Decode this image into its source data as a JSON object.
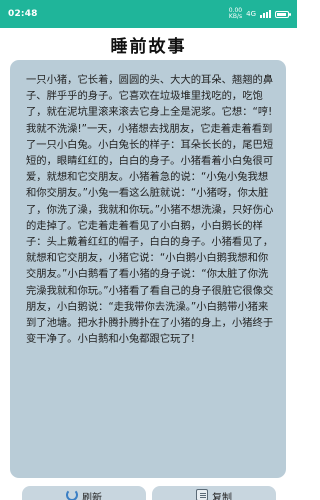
{
  "status_bar": {
    "time": "02:48",
    "speed_value": "0.00",
    "speed_unit": "KB/s",
    "network": "4G",
    "battery_level": 0.85
  },
  "header": {
    "title": "睡前故事"
  },
  "story": {
    "text": "一只小猪，它长着，圆圆的头、大大的耳朵、翘翘的鼻子、胖乎乎的身子。它喜欢在垃圾堆里找吃的，吃饱了，就在泥坑里滚来滚去它身上全是泥浆。它想：“哼!我就不洗澡!”一天，小猪想去找朋友，它走着走着看到了一只小白兔。小白兔长的样子：耳朵长长的，尾巴短短的，眼睛红红的，白白的身子。小猪看着小白兔很可爱，就想和它交朋友。小猪着急的说：“小兔小兔我想和你交朋友。”小兔一看这么脏就说：“小猪呀，你太脏了，你洗了澡，我就和你玩。”小猪不想洗澡，只好伤心的走掉了。它走着走着看见了小白鹅，小白鹅长的样子：头上戴着红红的帽子，白白的身子。小猪看见了，就想和它交朋友，小猪它说：“小白鹅小白鹅我想和你交朋友。”小白鹅看了看小猪的身子说：“你太脏了你洗完澡我就和你玩。”小猪看了看自己的身子很脏它很像交朋友，小白鹅说：“走我带你去洗澡。”小白鹅带小猪来到了池塘。把水扑腾扑腾扑在了小猪的身上，小猪终于变干净了。小白鹅和小兔都跟它玩了!"
  },
  "buttons": {
    "refresh_label": "刷新",
    "copy_label": "复制"
  },
  "colors": {
    "status_bar": "#1fb59a",
    "card": "#b9ccd7",
    "button": "#c8d6df"
  }
}
